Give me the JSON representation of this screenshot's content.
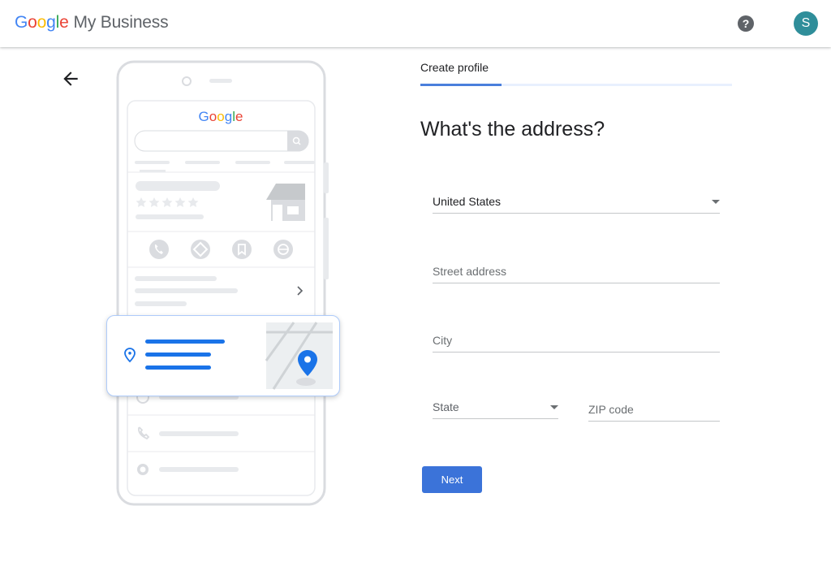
{
  "header": {
    "logo_letters": [
      "G",
      "o",
      "o",
      "g",
      "l",
      "e"
    ],
    "product_name": "My Business",
    "help_icon": "help-circle-icon",
    "help_glyph": "?",
    "avatar_initial": "S",
    "avatar_color": "#2f8e9a"
  },
  "illustration": {
    "brand_letters": [
      "G",
      "o",
      "o",
      "g",
      "l",
      "e"
    ],
    "brand_colors": [
      "#4285F4",
      "#EA4335",
      "#FBBC05",
      "#4285F4",
      "#34A853",
      "#EA4335"
    ],
    "icons": [
      "phone-icon",
      "directions-icon",
      "bookmark-icon",
      "globe-icon",
      "location-pin-icon",
      "clock-icon",
      "store-icon",
      "map-pin-icon",
      "chevron-right-icon",
      "search-icon"
    ]
  },
  "step": {
    "label": "Create profile",
    "progress": 0.26
  },
  "form": {
    "heading": "What's the address?",
    "country_value": "United States",
    "street_placeholder": "Street address",
    "city_placeholder": "City",
    "state_value": "State",
    "zip_placeholder": "ZIP code",
    "next_label": "Next"
  },
  "colors": {
    "primary": "#3b73d9",
    "progress_fill": "#4a7fdc",
    "progress_track": "#e8f0fe"
  }
}
